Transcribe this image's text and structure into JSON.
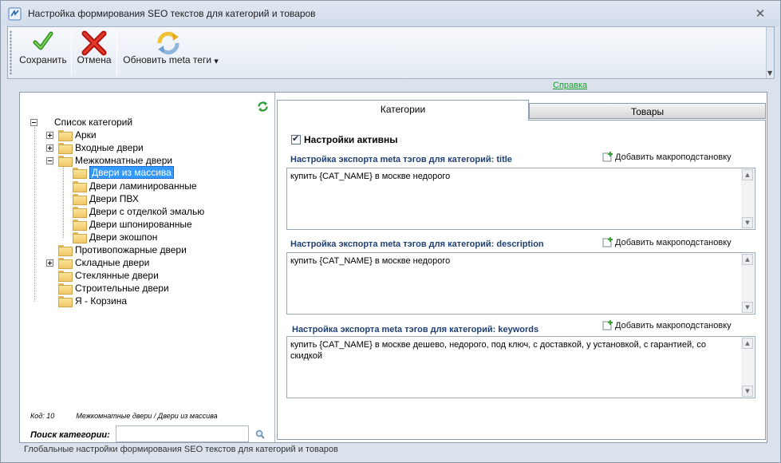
{
  "window": {
    "title": "Настройка формирования SEO текстов для категорий и товаров"
  },
  "toolbar": {
    "save_label": "Сохранить",
    "cancel_label": "Отмена",
    "refresh_label": "Обновить meta теги"
  },
  "help_link": "Справка",
  "tree": {
    "root": "Список категорий",
    "items": [
      {
        "label": "Арки"
      },
      {
        "label": "Входные двери"
      },
      {
        "label": "Межкомнатные двери"
      },
      {
        "label": "Двери из массива"
      },
      {
        "label": "Двери ламинированные"
      },
      {
        "label": "Двери ПВХ"
      },
      {
        "label": "Двери с отделкой эмалью"
      },
      {
        "label": "Двери шпонированные"
      },
      {
        "label": "Двери экошпон"
      },
      {
        "label": "Противопожарные двери"
      },
      {
        "label": "Складные двери"
      },
      {
        "label": "Стеклянные двери"
      },
      {
        "label": "Строительные двери"
      },
      {
        "label": "Я - Корзина"
      }
    ]
  },
  "selection": {
    "code": "Код: 10",
    "path": "Межкомнатные двери / Двери из массива"
  },
  "search": {
    "label": "Поиск категории:",
    "value": ""
  },
  "tabs": {
    "categories": "Категории",
    "goods": "Товары"
  },
  "settings": {
    "active_label": "Настройки активны",
    "active_checked": true,
    "macro_label": "Добавить макроподстановку",
    "sections": [
      {
        "title": "Настройка экспорта meta тэгов для категорий: title",
        "value": "купить {CAT_NAME} в москве недорого"
      },
      {
        "title": "Настройка экспорта meta тэгов для категорий: description",
        "value": "купить {CAT_NAME} в москве недорого"
      },
      {
        "title": "Настройка экспорта meta тэгов для категорий: keywords",
        "value": "купить {CAT_NAME} в москве дешево, недорого, под ключ, с доставкой, у установкой, с гарантией, со скидкой"
      }
    ]
  },
  "statusbar": "Глобальные настройки формирования SEO текстов для категорий и товаров",
  "colors": {
    "accent_link": "#1a9c2c",
    "section_title": "#1f3f73",
    "selection": "#3399ff"
  }
}
